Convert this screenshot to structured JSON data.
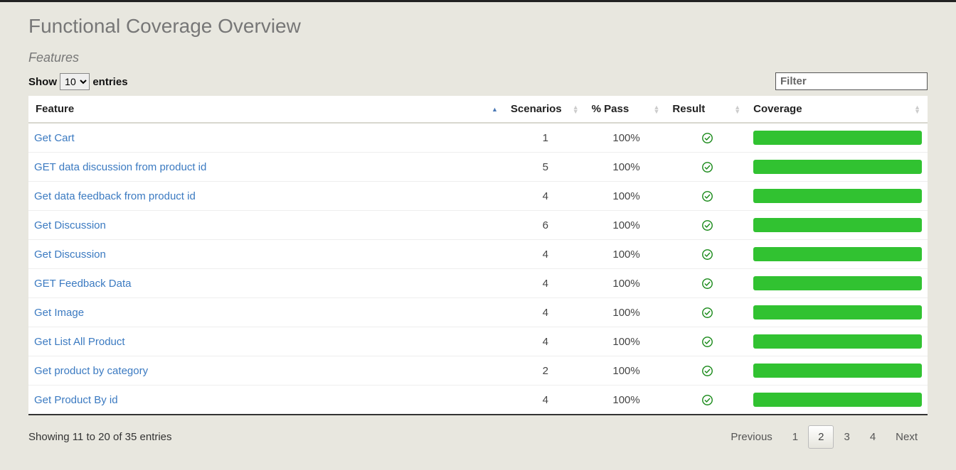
{
  "page": {
    "title": "Functional Coverage Overview",
    "section": "Features"
  },
  "controls": {
    "show_prefix": "Show",
    "show_suffix": "entries",
    "page_size_options": [
      "10"
    ],
    "page_size_selected": "10",
    "filter_placeholder": "Filter"
  },
  "columns": {
    "feature": "Feature",
    "scenarios": "Scenarios",
    "pass": "% Pass",
    "result": "Result",
    "coverage": "Coverage"
  },
  "rows": [
    {
      "feature": "Get Cart",
      "scenarios": "1",
      "pass": "100%",
      "result": "pass",
      "coverage": 100
    },
    {
      "feature": "GET data discussion from product id",
      "scenarios": "5",
      "pass": "100%",
      "result": "pass",
      "coverage": 100
    },
    {
      "feature": "Get data feedback from product id",
      "scenarios": "4",
      "pass": "100%",
      "result": "pass",
      "coverage": 100
    },
    {
      "feature": "Get Discussion",
      "scenarios": "6",
      "pass": "100%",
      "result": "pass",
      "coverage": 100
    },
    {
      "feature": "Get Discussion",
      "scenarios": "4",
      "pass": "100%",
      "result": "pass",
      "coverage": 100
    },
    {
      "feature": "GET Feedback Data",
      "scenarios": "4",
      "pass": "100%",
      "result": "pass",
      "coverage": 100
    },
    {
      "feature": "Get Image",
      "scenarios": "4",
      "pass": "100%",
      "result": "pass",
      "coverage": 100
    },
    {
      "feature": "Get List All Product",
      "scenarios": "4",
      "pass": "100%",
      "result": "pass",
      "coverage": 100
    },
    {
      "feature": "Get product by category",
      "scenarios": "2",
      "pass": "100%",
      "result": "pass",
      "coverage": 100
    },
    {
      "feature": "Get Product By id",
      "scenarios": "4",
      "pass": "100%",
      "result": "pass",
      "coverage": 100
    }
  ],
  "footer": {
    "info": "Showing 11 to 20 of 35 entries"
  },
  "pagination": {
    "previous": "Previous",
    "next": "Next",
    "pages": [
      "1",
      "2",
      "3",
      "4"
    ],
    "active": "2"
  }
}
